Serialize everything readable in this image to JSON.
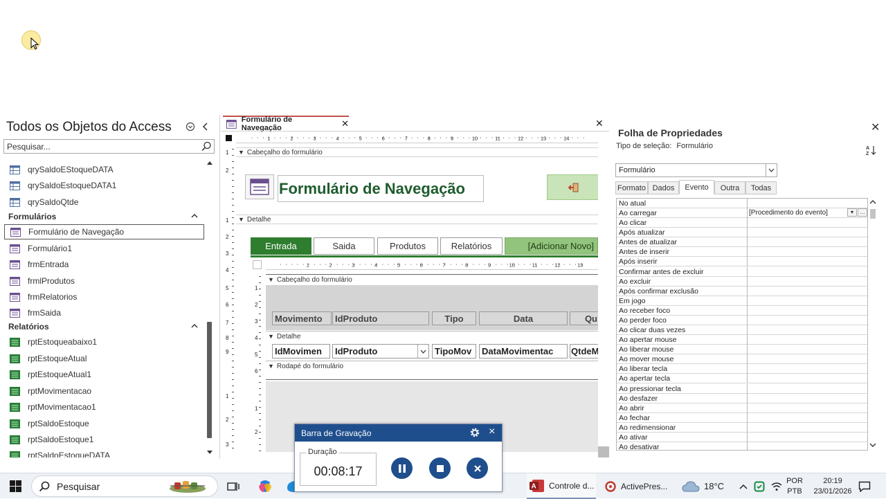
{
  "nav_pane": {
    "title": "Todos os Objetos do Access",
    "search_placeholder": "Pesquisar...",
    "queries": [
      "qrySaldoEStoqueDATA",
      "qrySaldoEstoqueDATA1",
      "qrySaldoQtde"
    ],
    "forms_group": "Formulários",
    "forms": [
      "Formulário de Navegação",
      "Formulário1",
      "frmEntrada",
      "frmlProdutos",
      "frmRelatorios",
      "frmSaida"
    ],
    "reports_group": "Relatórios",
    "reports": [
      "rptEstoqueabaixo1",
      "rptEstoqueAtual",
      "rptEstoqueAtual1",
      "rptMovimentacao",
      "rptMovimentacao1",
      "rptSaldoEstoque",
      "rptSaldoEstoque1",
      "rptSaldoEstoqueDATA"
    ]
  },
  "design": {
    "tab_label": "Formulário de Navegação",
    "ruler_labels": [
      "1",
      "2",
      "3",
      "4",
      "5",
      "6",
      "7",
      "8",
      "9",
      "10",
      "11",
      "12",
      "13",
      "14"
    ],
    "vruler_labels": [
      "1",
      "2",
      "1",
      "2",
      "3",
      "4",
      "5",
      "6",
      "7",
      "8",
      "9",
      "1",
      "2",
      "3"
    ],
    "section_header": "Cabeçalho do formulário",
    "section_detail": "Detalhe",
    "form_title": "Formulário de Navegação",
    "nav_tabs": [
      "Entrada",
      "Saida",
      "Produtos",
      "Relatórios",
      "[Adicionar Novo]"
    ],
    "sub_ruler_labels": [
      "1",
      "2",
      "3",
      "4",
      "5",
      "6",
      "7",
      "8",
      "9",
      "10",
      "11",
      "12",
      "13"
    ],
    "sub_vruler_labels": [
      "1",
      "2",
      "3",
      "4",
      "5",
      "6",
      "1",
      "2"
    ],
    "sub_header": "Cabeçalho do formulário",
    "sub_detail": "Detalhe",
    "sub_footer": "Rodapé do formulário",
    "column_labels": [
      "Movimento",
      "IdProduto",
      "Tipo",
      "Data",
      "Qu"
    ],
    "detail_fields": [
      "IdMovimen",
      "IdProduto",
      "TipoMov",
      "DataMovimentac",
      "QtdeM"
    ]
  },
  "props": {
    "title": "Folha de Propriedades",
    "selection_type_label": "Tipo de seleção:",
    "selection_type_value": "Formulário",
    "dropdown_value": "Formulário",
    "tabs": [
      "Formato",
      "Dados",
      "Evento",
      "Outra",
      "Todas"
    ],
    "active_tab": "Evento",
    "rows": [
      {
        "name": "No atual",
        "value": ""
      },
      {
        "name": "Ao carregar",
        "value": "[Procedimento do evento]"
      },
      {
        "name": "Ao clicar",
        "value": ""
      },
      {
        "name": "Após atualizar",
        "value": ""
      },
      {
        "name": "Antes de atualizar",
        "value": ""
      },
      {
        "name": "Antes de inserir",
        "value": ""
      },
      {
        "name": "Após inserir",
        "value": ""
      },
      {
        "name": "Confirmar antes de excluir",
        "value": ""
      },
      {
        "name": "Ao excluir",
        "value": ""
      },
      {
        "name": "Após confirmar exclusão",
        "value": ""
      },
      {
        "name": "Em jogo",
        "value": ""
      },
      {
        "name": "Ao receber foco",
        "value": ""
      },
      {
        "name": "Ao perder foco",
        "value": ""
      },
      {
        "name": "Ao clicar duas vezes",
        "value": ""
      },
      {
        "name": "Ao apertar mouse",
        "value": ""
      },
      {
        "name": "Ao liberar mouse",
        "value": ""
      },
      {
        "name": "Ao mover mouse",
        "value": ""
      },
      {
        "name": "Ao liberar tecla",
        "value": ""
      },
      {
        "name": "Ao apertar tecla",
        "value": ""
      },
      {
        "name": "Ao pressionar tecla",
        "value": ""
      },
      {
        "name": "Ao desfazer",
        "value": ""
      },
      {
        "name": "Ao abrir",
        "value": ""
      },
      {
        "name": "Ao fechar",
        "value": ""
      },
      {
        "name": "Ao redimensionar",
        "value": ""
      },
      {
        "name": "Ao ativar",
        "value": ""
      },
      {
        "name": "Ao desativar",
        "value": ""
      }
    ]
  },
  "recorder": {
    "title": "Barra de Gravação",
    "duration_label": "Duração",
    "time": "00:08:17"
  },
  "taskbar": {
    "search_label": "Pesquisar",
    "access_label": "Controle d...",
    "activepres_label": "ActivePres...",
    "temperature": "18°C",
    "lang_top": "POR",
    "lang_bottom": "PTB",
    "time": "20:19",
    "date": "23/01/2026"
  },
  "colors": {
    "accent_green": "#2f7d2f",
    "title_green": "#1f5c2e",
    "recorder_blue": "#1f4e8c"
  }
}
